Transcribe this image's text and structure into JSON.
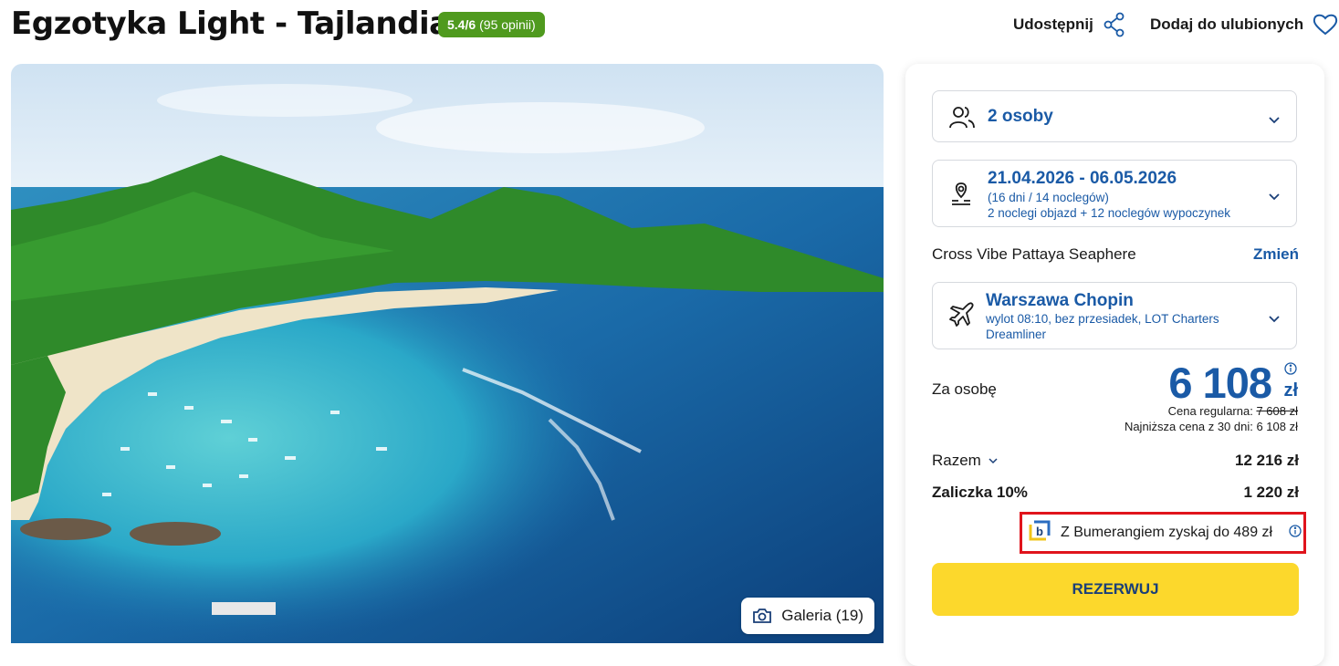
{
  "header": {
    "title": "Egzotyka Light - Tajlandia",
    "rating_score": "5.4/6",
    "rating_reviews": "(95 opinii)",
    "share_label": "Udostępnij",
    "favorite_label": "Dodaj do ulubionych"
  },
  "hero": {
    "gallery_label": "Galeria (19)"
  },
  "booking": {
    "persons": "2 osoby",
    "dates": "21.04.2026 - 06.05.2026",
    "dates_duration": "(16 dni / 14 noclegów)",
    "dates_detail": "2 noclegi objazd + 12 noclegów wypoczynek",
    "hotel_name": "Cross Vibe Pattaya Seaphere",
    "change_label": "Zmień",
    "airport": "Warszawa Chopin",
    "flight_line1": "wylot 08:10, bez przesiadek, LOT Charters",
    "flight_line2": "Dreamliner",
    "per_person_label": "Za osobę",
    "price": "6 108",
    "currency": "zł",
    "regular_label": "Cena regularna:",
    "regular_price": "7 608 zł",
    "lowest_30_days": "Najniższa cena z 30 dni: 6 108 zł",
    "total_label": "Razem",
    "total_value": "12 216 zł",
    "deposit_label": "Zaliczka 10%",
    "deposit_value": "1 220 zł",
    "bumerang_text": "Z Bumerangiem zyskaj do 489 zł",
    "reserve_label": "REZERWUJ"
  },
  "colors": {
    "accent_blue": "#1a5aa6",
    "rating_green": "#4f9a1e",
    "reserve_yellow": "#fcd82c",
    "highlight_red": "#e0141c"
  }
}
